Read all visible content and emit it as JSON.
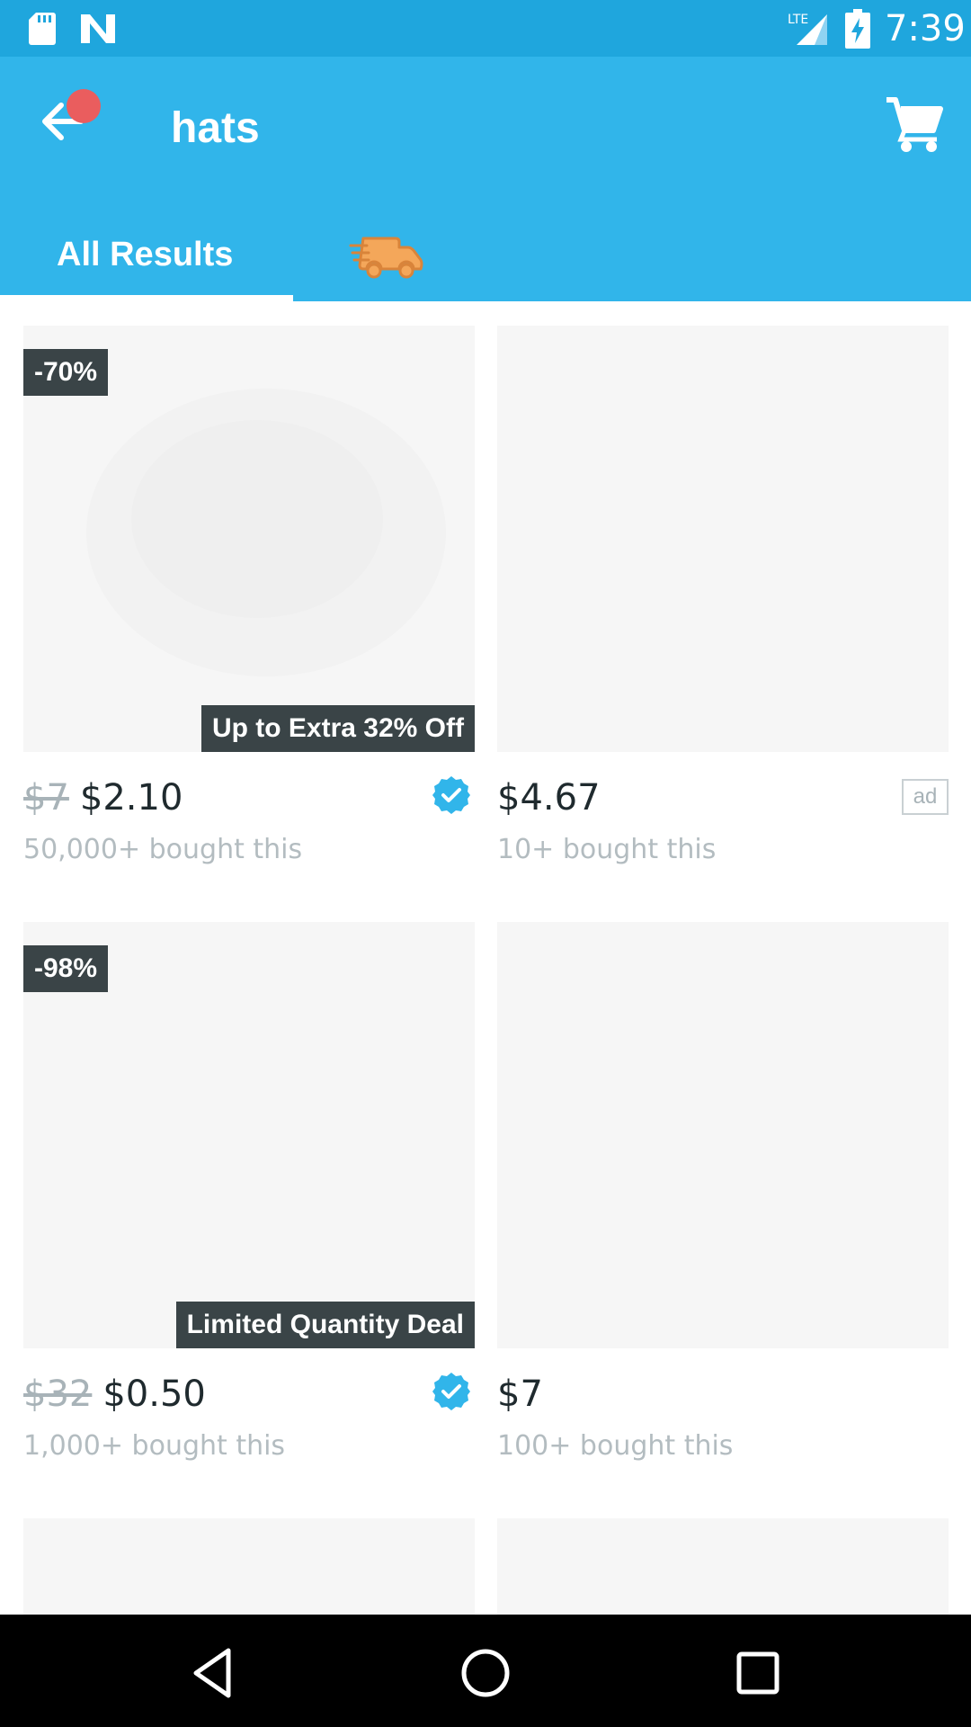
{
  "status_bar": {
    "time": "7:39",
    "network": "LTE",
    "icons": [
      "sd-card-icon",
      "n-notification-icon",
      "signal-icon",
      "battery-charging-icon"
    ]
  },
  "app_bar": {
    "search_query": "hats",
    "back_icon": "arrow-left-icon",
    "cart_icon": "shopping-cart-icon",
    "notification_dot_color": "#ea5d5e",
    "background_color": "#31b5ea"
  },
  "tabs": [
    {
      "label": "All Results",
      "selected": true
    },
    {
      "label": "",
      "icon": "fast-shipping-truck-icon",
      "selected": false
    }
  ],
  "products": [
    {
      "old_price": "$7",
      "price": "$2.10",
      "discount": "-70%",
      "promo": "Up to Extra 32% Off",
      "verified": true,
      "ad": false,
      "bought": "50,000+ bought this"
    },
    {
      "old_price": "",
      "price": "$4.67",
      "discount": "",
      "promo": "",
      "verified": false,
      "ad": true,
      "ad_label": "ad",
      "bought": "10+ bought this"
    },
    {
      "old_price": "$32",
      "price": "$0.50",
      "discount": "-98%",
      "promo": "Limited Quantity Deal",
      "verified": true,
      "ad": false,
      "bought": "1,000+ bought this"
    },
    {
      "old_price": "",
      "price": "$7",
      "discount": "",
      "promo": "",
      "verified": false,
      "ad": false,
      "bought": "100+ bought this"
    }
  ],
  "nav_bar": {
    "buttons": [
      "back-triangle-icon",
      "home-circle-icon",
      "recents-square-icon"
    ]
  },
  "colors": {
    "status_bar": "#1fa6dd",
    "accent": "#31b5ea",
    "badge": "#3a4447",
    "verified": "#31b5ea"
  }
}
